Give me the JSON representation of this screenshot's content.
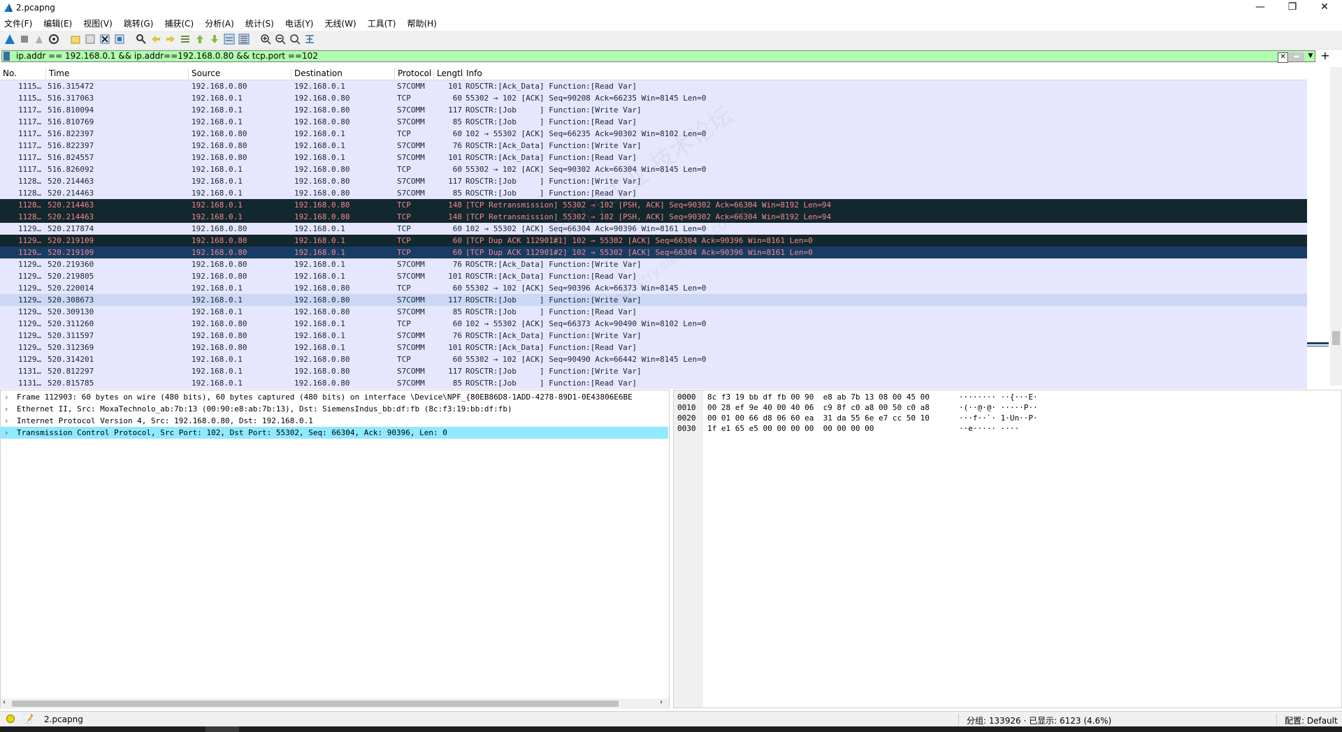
{
  "window": {
    "title": "2.pcapng"
  },
  "menu": [
    "文件(F)",
    "编辑(E)",
    "视图(V)",
    "跳转(G)",
    "捕获(C)",
    "分析(A)",
    "统计(S)",
    "电话(Y)",
    "无线(W)",
    "工具(T)",
    "帮助(H)"
  ],
  "filter": {
    "value": "ip.addr == 192.168.0.1 && ip.addr==192.168.0.80 && tcp.port ==102"
  },
  "columns": [
    "No.",
    "Time",
    "Source",
    "Destination",
    "Protocol",
    "Lengtl",
    "Info"
  ],
  "packets": [
    {
      "no": "1115…",
      "time": "516.315472",
      "src": "192.168.0.80",
      "dst": "192.168.0.1",
      "proto": "S7COMM",
      "len": "101",
      "info": "ROSCTR:[Ack_Data] Function:[Read Var]",
      "style": "normal"
    },
    {
      "no": "1115…",
      "time": "516.317063",
      "src": "192.168.0.1",
      "dst": "192.168.0.80",
      "proto": "TCP",
      "len": "60",
      "info": "55302 → 102 [ACK] Seq=90208 Ack=66235 Win=8145 Len=0",
      "style": "tcp"
    },
    {
      "no": "1117…",
      "time": "516.810094",
      "src": "192.168.0.1",
      "dst": "192.168.0.80",
      "proto": "S7COMM",
      "len": "117",
      "info": "ROSCTR:[Job     ] Function:[Write Var]",
      "style": "normal"
    },
    {
      "no": "1117…",
      "time": "516.810769",
      "src": "192.168.0.1",
      "dst": "192.168.0.80",
      "proto": "S7COMM",
      "len": "85",
      "info": "ROSCTR:[Job     ] Function:[Read Var]",
      "style": "normal"
    },
    {
      "no": "1117…",
      "time": "516.822397",
      "src": "192.168.0.80",
      "dst": "192.168.0.1",
      "proto": "TCP",
      "len": "60",
      "info": "102 → 55302 [ACK] Seq=66235 Ack=90302 Win=8102 Len=0",
      "style": "tcp"
    },
    {
      "no": "1117…",
      "time": "516.822397",
      "src": "192.168.0.80",
      "dst": "192.168.0.1",
      "proto": "S7COMM",
      "len": "76",
      "info": "ROSCTR:[Ack_Data] Function:[Write Var]",
      "style": "normal"
    },
    {
      "no": "1117…",
      "time": "516.824557",
      "src": "192.168.0.80",
      "dst": "192.168.0.1",
      "proto": "S7COMM",
      "len": "101",
      "info": "ROSCTR:[Ack_Data] Function:[Read Var]",
      "style": "normal"
    },
    {
      "no": "1117…",
      "time": "516.826092",
      "src": "192.168.0.1",
      "dst": "192.168.0.80",
      "proto": "TCP",
      "len": "60",
      "info": "55302 → 102 [ACK] Seq=90302 Ack=66304 Win=8145 Len=0",
      "style": "tcp"
    },
    {
      "no": "1128…",
      "time": "520.214463",
      "src": "192.168.0.1",
      "dst": "192.168.0.80",
      "proto": "S7COMM",
      "len": "117",
      "info": "ROSCTR:[Job     ] Function:[Write Var]",
      "style": "normal"
    },
    {
      "no": "1128…",
      "time": "520.214463",
      "src": "192.168.0.1",
      "dst": "192.168.0.80",
      "proto": "S7COMM",
      "len": "85",
      "info": "ROSCTR:[Job     ] Function:[Read Var]",
      "style": "normal"
    },
    {
      "no": "1128…",
      "time": "520.214463",
      "src": "192.168.0.1",
      "dst": "192.168.0.80",
      "proto": "TCP",
      "len": "148",
      "info": "[TCP Retransmission] 55302 → 102 [PSH, ACK] Seq=90302 Ack=66304 Win=8192 Len=94",
      "style": "alert"
    },
    {
      "no": "1128…",
      "time": "520.214463",
      "src": "192.168.0.1",
      "dst": "192.168.0.80",
      "proto": "TCP",
      "len": "148",
      "info": "[TCP Retransmission] 55302 → 102 [PSH, ACK] Seq=90302 Ack=66304 Win=8192 Len=94",
      "style": "alert"
    },
    {
      "no": "1129…",
      "time": "520.217874",
      "src": "192.168.0.80",
      "dst": "192.168.0.1",
      "proto": "TCP",
      "len": "60",
      "info": "102 → 55302 [ACK] Seq=66304 Ack=90396 Win=8161 Len=0",
      "style": "tcp"
    },
    {
      "no": "1129…",
      "time": "520.219109",
      "src": "192.168.0.80",
      "dst": "192.168.0.1",
      "proto": "TCP",
      "len": "60",
      "info": "[TCP Dup ACK 112901#1] 102 → 55302 [ACK] Seq=66304 Ack=90396 Win=8161 Len=0",
      "style": "alert"
    },
    {
      "no": "1129…",
      "time": "520.219109",
      "src": "192.168.0.80",
      "dst": "192.168.0.1",
      "proto": "TCP",
      "len": "60",
      "info": "[TCP Dup ACK 112901#2] 102 → 55302 [ACK] Seq=66304 Ack=90396 Win=8161 Len=0",
      "style": "selected"
    },
    {
      "no": "1129…",
      "time": "520.219360",
      "src": "192.168.0.80",
      "dst": "192.168.0.1",
      "proto": "S7COMM",
      "len": "76",
      "info": "ROSCTR:[Ack_Data] Function:[Write Var]",
      "style": "normal"
    },
    {
      "no": "1129…",
      "time": "520.219805",
      "src": "192.168.0.80",
      "dst": "192.168.0.1",
      "proto": "S7COMM",
      "len": "101",
      "info": "ROSCTR:[Ack_Data] Function:[Read Var]",
      "style": "normal"
    },
    {
      "no": "1129…",
      "time": "520.220014",
      "src": "192.168.0.1",
      "dst": "192.168.0.80",
      "proto": "TCP",
      "len": "60",
      "info": "55302 → 102 [ACK] Seq=90396 Ack=66373 Win=8145 Len=0",
      "style": "tcp"
    },
    {
      "no": "1129…",
      "time": "520.308673",
      "src": "192.168.0.1",
      "dst": "192.168.0.80",
      "proto": "S7COMM",
      "len": "117",
      "info": "ROSCTR:[Job     ] Function:[Write Var]",
      "style": "hover"
    },
    {
      "no": "1129…",
      "time": "520.309130",
      "src": "192.168.0.1",
      "dst": "192.168.0.80",
      "proto": "S7COMM",
      "len": "85",
      "info": "ROSCTR:[Job     ] Function:[Read Var]",
      "style": "normal"
    },
    {
      "no": "1129…",
      "time": "520.311260",
      "src": "192.168.0.80",
      "dst": "192.168.0.1",
      "proto": "TCP",
      "len": "60",
      "info": "102 → 55302 [ACK] Seq=66373 Ack=90490 Win=8102 Len=0",
      "style": "tcp"
    },
    {
      "no": "1129…",
      "time": "520.311597",
      "src": "192.168.0.80",
      "dst": "192.168.0.1",
      "proto": "S7COMM",
      "len": "76",
      "info": "ROSCTR:[Ack_Data] Function:[Write Var]",
      "style": "normal"
    },
    {
      "no": "1129…",
      "time": "520.312369",
      "src": "192.168.0.80",
      "dst": "192.168.0.1",
      "proto": "S7COMM",
      "len": "101",
      "info": "ROSCTR:[Ack_Data] Function:[Read Var]",
      "style": "normal"
    },
    {
      "no": "1129…",
      "time": "520.314201",
      "src": "192.168.0.1",
      "dst": "192.168.0.80",
      "proto": "TCP",
      "len": "60",
      "info": "55302 → 102 [ACK] Seq=90490 Ack=66442 Win=8145 Len=0",
      "style": "tcp"
    },
    {
      "no": "1131…",
      "time": "520.812297",
      "src": "192.168.0.1",
      "dst": "192.168.0.80",
      "proto": "S7COMM",
      "len": "117",
      "info": "ROSCTR:[Job     ] Function:[Write Var]",
      "style": "normal"
    },
    {
      "no": "1131…",
      "time": "520.815785",
      "src": "192.168.0.1",
      "dst": "192.168.0.80",
      "proto": "S7COMM",
      "len": "85",
      "info": "ROSCTR:[Job     ] Function:[Read Var]",
      "style": "normal"
    }
  ],
  "details": [
    "Frame 112903: 60 bytes on wire (480 bits), 60 bytes captured (480 bits) on interface \\Device\\NPF_{80EB86D8-1ADD-4278-89D1-0E43806E6BE",
    "Ethernet II, Src: MoxaTechnolo_ab:7b:13 (00:90:e8:ab:7b:13), Dst: SiemensIndus_bb:df:fb (8c:f3:19:bb:df:fb)",
    "Internet Protocol Version 4, Src: 192.168.0.80, Dst: 192.168.0.1",
    "Transmission Control Protocol, Src Port: 102, Dst Port: 55302, Seq: 66304, Ack: 90396, Len: 0"
  ],
  "selected_detail": 3,
  "bytes": [
    {
      "off": "0000",
      "hex": "8c f3 19 bb df fb 00 90  e8 ab 7b 13 08 00 45 00",
      "ascii": "········ ··{···E·"
    },
    {
      "off": "0010",
      "hex": "00 28 ef 9e 40 00 40 06  c9 8f c0 a8 00 50 c0 a8",
      "ascii": "·(··@·@· ·····P··"
    },
    {
      "off": "0020",
      "hex": "00 01 00 66 d8 06 60 ea  31 da 55 6e e7 cc 50 10",
      "ascii": "···f··`· 1·Un··P·"
    },
    {
      "off": "0030",
      "hex": "1f e1 65 e5 00 00 00 00  00 00 00 00",
      "ascii": "··e····· ····"
    }
  ],
  "status": {
    "file": "2.pcapng",
    "stats": "分组: 133926 · 已显示: 6123 (4.6%)",
    "profile": "配置: Default"
  },
  "watermark": {
    "line1": "西门子工业  技术论坛",
    "line2": "support.industry.siemens.com/cs"
  },
  "colors": {
    "alert_bg": "#12272e",
    "alert_fg": "#f78787",
    "normal_bg": "#e7e6ff",
    "filter_ok": "#afffaf",
    "selected_bg": "#173d66",
    "detail_sel": "#8fe9ff"
  }
}
